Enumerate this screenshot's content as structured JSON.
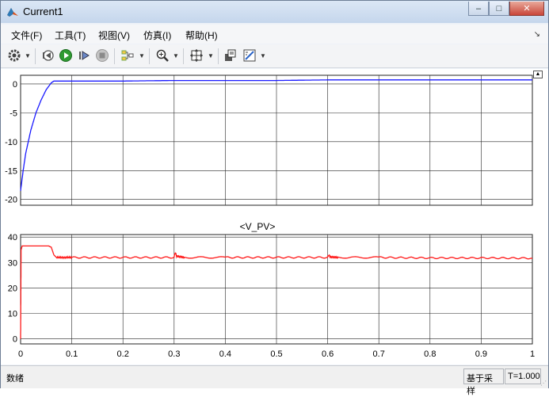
{
  "window": {
    "title": "Current1",
    "minimize_glyph": "–",
    "maximize_glyph": "□",
    "close_glyph": "✕"
  },
  "menu": {
    "items": [
      "文件(F)",
      "工具(T)",
      "视图(V)",
      "仿真(I)",
      "帮助(H)"
    ],
    "overflow_glyph": "↘"
  },
  "toolbar": {
    "icons": [
      "gear-icon",
      "step-back-icon",
      "run-icon",
      "step-forward-icon",
      "stop-icon",
      "signal-select-icon",
      "zoom-icon",
      "fit-view-icon",
      "layout-icon",
      "style-icon"
    ]
  },
  "colors": {
    "plot1_line": "#1a1aff",
    "plot2_line": "#ff1a1a",
    "grid": "#262626"
  },
  "plots": {
    "top": {
      "title": "",
      "yticks": [
        "0",
        "-5",
        "-10",
        "-15",
        "-20"
      ],
      "yvalues": [
        0,
        -5,
        -10,
        -15,
        -20
      ],
      "ylim": [
        -21,
        1.5
      ]
    },
    "bottom": {
      "title": "<V_PV>",
      "yticks": [
        "40",
        "30",
        "20",
        "10",
        "0"
      ],
      "yvalues": [
        40,
        30,
        20,
        10,
        0
      ],
      "ylim": [
        -2,
        41
      ]
    },
    "xticks": [
      "0",
      "0.1",
      "0.2",
      "0.3",
      "0.4",
      "0.5",
      "0.6",
      "0.7",
      "0.8",
      "0.9",
      "1"
    ],
    "xvalues": [
      0,
      0.1,
      0.2,
      0.3,
      0.4,
      0.5,
      0.6,
      0.7,
      0.8,
      0.9,
      1.0
    ],
    "xlim": [
      0,
      1
    ]
  },
  "chart_data": [
    {
      "type": "line",
      "title": "",
      "x": [
        0,
        0.005,
        0.01,
        0.02,
        0.03,
        0.04,
        0.05,
        0.06,
        0.065,
        0.1,
        0.2,
        0.3,
        0.4,
        0.5,
        0.6,
        0.7,
        0.8,
        0.9,
        1.0
      ],
      "series": [
        {
          "values": [
            -18.5,
            -15,
            -12,
            -8,
            -5,
            -2.8,
            -1,
            0.2,
            0.5,
            0.5,
            0.5,
            0.6,
            0.6,
            0.6,
            0.7,
            0.7,
            0.7,
            0.7,
            0.7
          ]
        }
      ],
      "ylim": [
        -21,
        1.5
      ],
      "xlim": [
        0,
        1
      ],
      "grid": true
    },
    {
      "type": "line",
      "title": "<V_PV>",
      "x": [
        0,
        0.001,
        0.003,
        0.005,
        0.055,
        0.06,
        0.065,
        0.07,
        0.1,
        0.2,
        0.3,
        0.302,
        0.305,
        0.32,
        0.4,
        0.5,
        0.6,
        0.602,
        0.605,
        0.62,
        0.7,
        0.8,
        0.9,
        1.0
      ],
      "series": [
        {
          "values": [
            0,
            35,
            36.5,
            36.5,
            36.5,
            36,
            33,
            32,
            32,
            32,
            32,
            34,
            32.5,
            32,
            32,
            32,
            32,
            33,
            32.2,
            32,
            32,
            31.8,
            31.8,
            31.7
          ]
        }
      ],
      "ylim": [
        -2,
        41
      ],
      "xlim": [
        0,
        1
      ],
      "grid": true
    }
  ],
  "status": {
    "left": "数绪",
    "mode": "基于采样",
    "time": "T=1.000"
  }
}
